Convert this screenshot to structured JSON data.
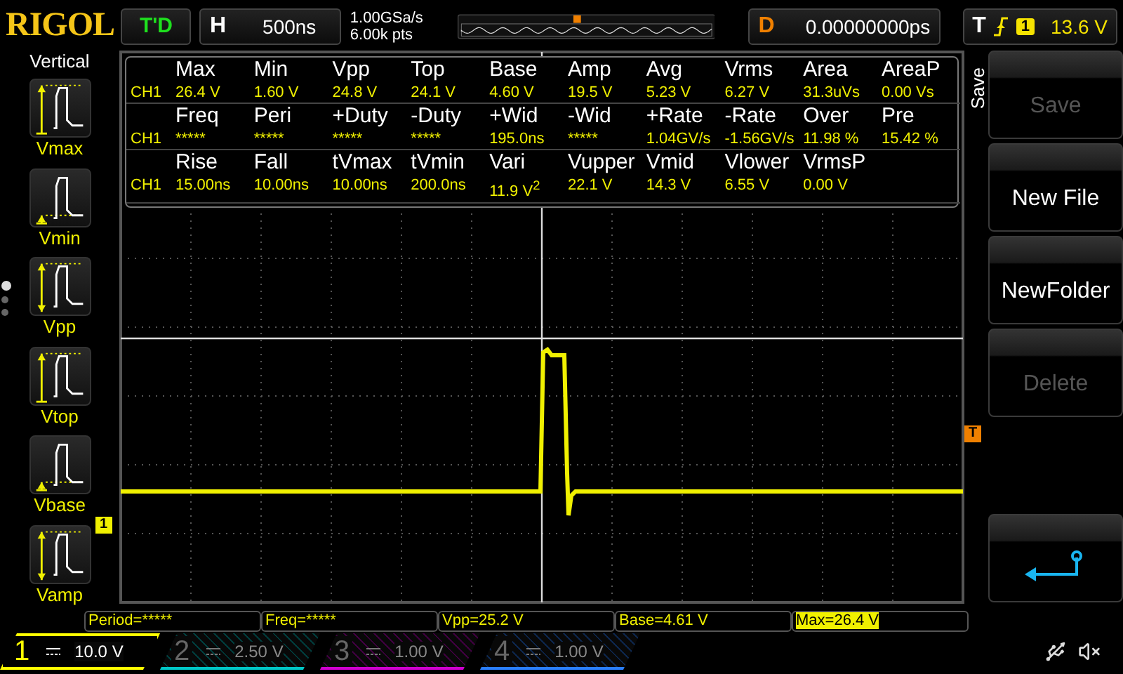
{
  "brand": "RIGOL",
  "run_status": "T'D",
  "horizontal": {
    "label": "H",
    "timebase": "500ns",
    "sample_rate": "1.00GSa/s",
    "memory_depth": "6.00k pts"
  },
  "delay": {
    "label": "D",
    "value": "0.00000000ps"
  },
  "trigger": {
    "label": "T",
    "channel": "1",
    "level": "13.6 V"
  },
  "sidebar": {
    "title": "Vertical",
    "items": [
      {
        "label": "Vmax",
        "kind": "max"
      },
      {
        "label": "Vmin",
        "kind": "min"
      },
      {
        "label": "Vpp",
        "kind": "vpp"
      },
      {
        "label": "Vtop",
        "kind": "top"
      },
      {
        "label": "Vbase",
        "kind": "base"
      },
      {
        "label": "Vamp",
        "kind": "amp"
      }
    ],
    "pages": [
      {
        "selected": true
      },
      {
        "selected": false
      },
      {
        "selected": false
      }
    ]
  },
  "measurements": [
    {
      "channel": "CH1",
      "headers": [
        "Max",
        "Min",
        "Vpp",
        "Top",
        "Base",
        "Amp",
        "Avg",
        "Vrms",
        "Area",
        "AreaP"
      ],
      "values": [
        "26.4 V",
        "1.60 V",
        "24.8 V",
        "24.1 V",
        "4.60 V",
        "19.5 V",
        "5.23 V",
        "6.27 V",
        "31.3uVs",
        "0.00 Vs"
      ]
    },
    {
      "channel": "CH1",
      "headers": [
        "Freq",
        "Peri",
        "+Duty",
        "-Duty",
        "+Wid",
        "-Wid",
        "+Rate",
        "-Rate",
        "Over",
        "Pre"
      ],
      "values": [
        "*****",
        "*****",
        "*****",
        "*****",
        "195.0ns",
        "*****",
        "1.04GV/s",
        "-1.56GV/s",
        "11.98 %",
        "15.42 %"
      ]
    },
    {
      "channel": "CH1",
      "headers": [
        "Rise",
        "Fall",
        "tVmax",
        "tVmin",
        "Vari",
        "Vupper",
        "Vmid",
        "Vlower",
        "VrmsP"
      ],
      "values": [
        "15.00ns",
        "10.00ns",
        "10.00ns",
        "200.0ns",
        "11.9 V$^{2}$",
        "22.1 V",
        "14.3 V",
        "6.55 V",
        "0.00 V"
      ]
    }
  ],
  "markers": {
    "channel": "1",
    "trigger": "T"
  },
  "menu": {
    "title": "Save",
    "buttons": [
      {
        "kind": "text",
        "label": "Save",
        "disabled": true
      },
      {
        "kind": "text",
        "label": "New File",
        "disabled": false
      },
      {
        "kind": "text",
        "label": "NewFolder",
        "disabled": false
      },
      {
        "kind": "text",
        "label": "Delete",
        "disabled": true
      },
      {
        "kind": "return"
      }
    ]
  },
  "readouts": [
    {
      "text": "Period=*****",
      "highlighted": false
    },
    {
      "text": "Freq=*****",
      "highlighted": false
    },
    {
      "text": "Vpp=25.2 V",
      "highlighted": false
    },
    {
      "text": "Base=4.61 V",
      "highlighted": false
    },
    {
      "text": "Max=26.4 V",
      "highlighted": true
    }
  ],
  "channels": [
    {
      "number": "1",
      "scale": "10.0 V",
      "on": true,
      "color": "#ffff00"
    },
    {
      "number": "2",
      "scale": "2.50 V",
      "on": false,
      "color": "#00c8c8"
    },
    {
      "number": "3",
      "scale": "1.00 V",
      "on": false,
      "color": "#d000d0"
    },
    {
      "number": "4",
      "scale": "1.00 V",
      "on": false,
      "color": "#2a7fff"
    }
  ]
}
